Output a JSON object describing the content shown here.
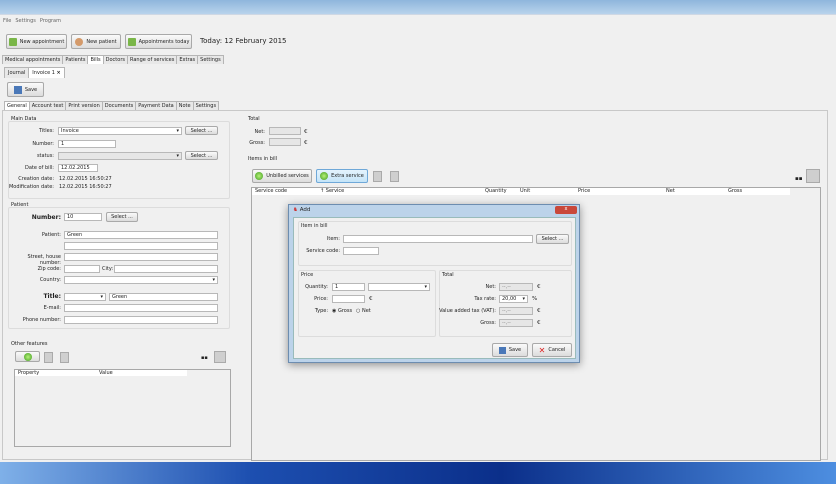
{
  "menu": [
    "File",
    "Settings",
    "Program"
  ],
  "toolbar": {
    "new_appointment": "New appointment",
    "new_patient": "New patient",
    "appointments_today": "Appointments today",
    "today": "Today: 12 February 2015"
  },
  "main_tabs": [
    "Medical appointments",
    "Patients",
    "Bills",
    "Doctors",
    "Range of services",
    "Extras",
    "Settings"
  ],
  "doc_tabs": {
    "journal": "Journal",
    "invoice": "Invoice 1",
    "close": "×"
  },
  "save": "Save",
  "inner_tabs": [
    "General",
    "Account text",
    "Print version",
    "Documents",
    "Payment Data",
    "Note",
    "Settings"
  ],
  "main_data": {
    "title": "Main Data",
    "titles_label": "Titles:",
    "titles_value": "Invoice",
    "select": "Select ...",
    "number_label": "Number:",
    "number_value": "1",
    "status_label": "status:",
    "status_value": "",
    "date_label": "Date of bill:",
    "date_value": "12.02.2015",
    "creation_label": "Creation date:",
    "creation_value": "12.02.2015  16:50:27",
    "modification_label": "Modification date:",
    "modification_value": "12.02.2015  16:50:27"
  },
  "patient": {
    "title": "Patient",
    "number_label": "Number:",
    "number_value": "10",
    "select": "Select ...",
    "patient_label": "Patient:",
    "patient_value": "Green",
    "street_label": "Street, house number:",
    "zip_label": "Zip code:",
    "city_label": "City:",
    "country_label": "Country:",
    "title_label": "Title:",
    "title_value": "",
    "name_value": "Green",
    "email_label": "E-mail:",
    "phone_label": "Phone number:"
  },
  "other": {
    "title": "Other features",
    "columns": [
      "Property",
      "Value"
    ]
  },
  "total": {
    "title": "Total",
    "net_label": "Net:",
    "gross_label": "Gross:",
    "currency": "€"
  },
  "items": {
    "title": "Items in bill",
    "unbilled": "Unbilled services",
    "extra": "Extra service",
    "columns": [
      "Service code",
      "Service",
      "Quantity",
      "Unit",
      "Price",
      "Net",
      "Gross"
    ]
  },
  "dialog": {
    "title": "Add",
    "close": "x",
    "item_group": "Item in bill",
    "item_label": "Item:",
    "item_value": "",
    "select": "Select ...",
    "code_label": "Service code:",
    "price_group": "Price",
    "quantity_label": "Quantity:",
    "quantity_value": "1",
    "price_label": "Price:",
    "currency": "€",
    "type_label": "Type:",
    "gross": "Gross",
    "net": "Net",
    "type_selected": "Gross",
    "total_group": "Total",
    "net_label": "Net:",
    "net_value": "--,--",
    "tax_label": "Tax rate:",
    "tax_value": "20,00",
    "percent": "%",
    "vat_label": "Value added tax (VAT):",
    "vat_value": "--,--",
    "gross_label": "Gross:",
    "gross_value": "--,--",
    "save": "Save",
    "cancel": "Cancel"
  }
}
